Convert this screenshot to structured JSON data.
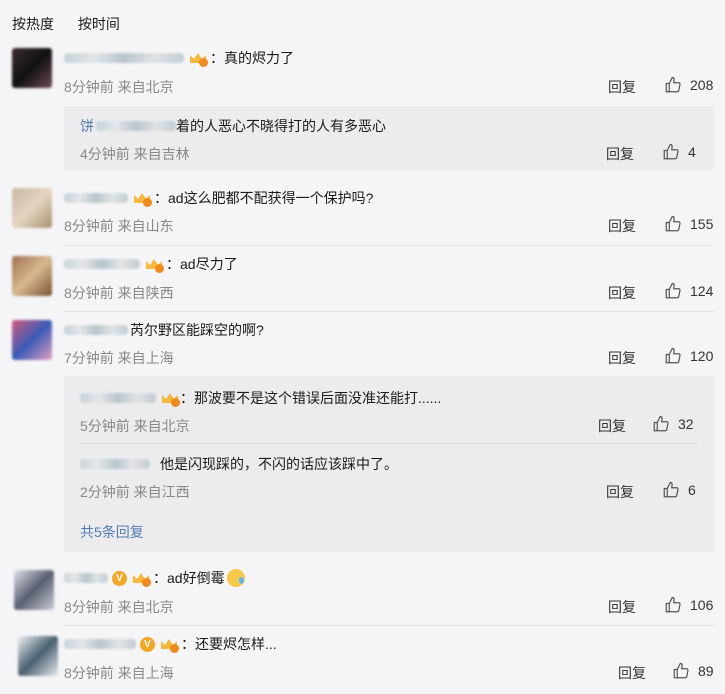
{
  "sort": {
    "hot": "按热度",
    "time": "按时间"
  },
  "reply_label": "回复",
  "comments": [
    {
      "text": "：真的烬力了",
      "meta": "8分钟前 来自北京",
      "likes": "208"
    },
    {
      "text": "：ad这么肥都不配获得一个保护吗?",
      "meta": "8分钟前 来自山东",
      "likes": "155"
    },
    {
      "text": "：ad尽力了",
      "meta": "8分钟前 来自陕西",
      "likes": "124"
    },
    {
      "text": "芮尔野区能踩空的啊?",
      "meta": "7分钟前 来自上海",
      "likes": "120"
    },
    {
      "text": "：ad好倒霉",
      "meta": "8分钟前 来自北京",
      "likes": "106"
    },
    {
      "text": "：还要烬怎样...",
      "meta": "8分钟前 来自上海",
      "likes": "89"
    }
  ],
  "subreplies": [
    {
      "name": "饼",
      "text": "着的人恶心不晓得打的人有多恶心",
      "meta": "4分钟前 来自吉林",
      "likes": "4"
    },
    {
      "text": "：那波要不是这个错误后面没准还能打......",
      "meta": "5分钟前 来自北京",
      "likes": "32"
    },
    {
      "text": "他是闪现踩的，不闪的话应该踩中了。",
      "meta": "2分钟前 来自江西",
      "likes": "6"
    }
  ],
  "more_replies": "共5条回复",
  "colors": {
    "link": "#507daf",
    "meta": "#888888",
    "background": "#f5f5f7",
    "subbox": "#ececef"
  }
}
